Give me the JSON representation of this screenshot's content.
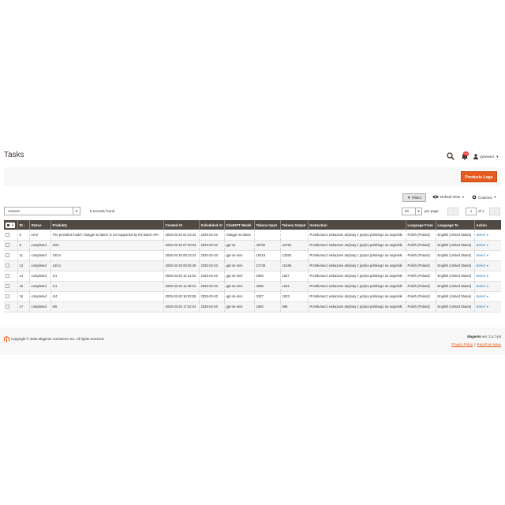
{
  "header": {
    "title": "Tasks",
    "notification_count": "99",
    "username": "sylwester"
  },
  "action_bar": {
    "primary_button": "Products Logs"
  },
  "toolbar": {
    "filters_label": "Filters",
    "view_label": "Default View",
    "columns_label": "Columns",
    "actions_label": "Actions",
    "records_found": "8 records found",
    "per_page_value": "20",
    "per_page_label": "per page",
    "current_page": "1",
    "page_of": "of 1"
  },
  "grid": {
    "columns": [
      "ID",
      "Status",
      "Produkty",
      "Created At",
      "Scheduled At",
      "ChatGPT Model",
      "Tokens Input",
      "Tokens Output",
      "Instruction",
      "Language From",
      "Language To",
      "Action"
    ],
    "action_link": "Select",
    "rows": [
      {
        "id": "6",
        "status": "error",
        "products": "The provided model 'chatgpt-4o-latest' is not supported by the Batch API.",
        "created": "2025-02-20 01:23:32",
        "scheduled": "2025-02-20",
        "model": "chatgpt-4o-latest",
        "tin": "",
        "tout": "",
        "instruction": "Przetłumacz wskazane atrybuty z języka polskiego na angielski",
        "lang_from": "Polish (Poland)",
        "lang_to": "English (United States)"
      },
      {
        "id": "9",
        "status": "completed",
        "products": "3/24",
        "created": "2025-02-20 07:20:04",
        "scheduled": "2025-02-20",
        "model": "gpt-4o",
        "tin": "46782",
        "tout": "22782",
        "instruction": "Przetłumacz wskazane atrybuty z języka polskiego na angielski",
        "lang_from": "Polish (Poland)",
        "lang_to": "English (United States)"
      },
      {
        "id": "11",
        "status": "completed",
        "products": "10/24",
        "created": "2025-02-20 08:13:42",
        "scheduled": "2025-02-20",
        "model": "gpt-4o-mini",
        "tin": "19218",
        "tout": "13393",
        "instruction": "Przetłumacz wskazane atrybuty z języka polskiego na angielski",
        "lang_from": "Polish (Poland)",
        "lang_to": "English (United States)"
      },
      {
        "id": "12",
        "status": "completed",
        "products": "14/14",
        "created": "2025-02-20 09:05:29",
        "scheduled": "2025-02-20",
        "model": "gpt-4o-mini",
        "tin": "21749",
        "tout": "15186",
        "instruction": "Przetłumacz wskazane atrybuty z języka polskiego na angielski",
        "lang_from": "Polish (Poland)",
        "lang_to": "English (United States)"
      },
      {
        "id": "14",
        "status": "completed",
        "products": "1/1",
        "created": "2025-02-20 11:14:52",
        "scheduled": "2025-02-20",
        "model": "gpt-4o-mini",
        "tin": "2056",
        "tout": "1647",
        "instruction": "Przetłumacz wskazane atrybuty z języka polskiego na angielski",
        "lang_from": "Polish (Poland)",
        "lang_to": "English (United States)"
      },
      {
        "id": "15",
        "status": "completed",
        "products": "1/1",
        "created": "2025-02-20 11:29:04",
        "scheduled": "2025-02-20",
        "model": "gpt-4o-mini",
        "tin": "2035",
        "tout": "1622",
        "instruction": "Przetłumacz wskazane atrybuty z języka polskiego na angielski",
        "lang_from": "Polish (Poland)",
        "lang_to": "English (United States)"
      },
      {
        "id": "16",
        "status": "completed",
        "products": "4/4",
        "created": "2025-02-20 16:02:55",
        "scheduled": "2025-02-20",
        "model": "gpt-4o-mini",
        "tin": "3327",
        "tout": "1823",
        "instruction": "Przetłumacz wskazane atrybuty z języka polskiego na angielski",
        "lang_from": "Polish (Poland)",
        "lang_to": "English (United States)"
      },
      {
        "id": "17",
        "status": "completed",
        "products": "6/6",
        "created": "2025-02-20 17:02:04",
        "scheduled": "2025-02-20",
        "model": "gpt-4o-mini",
        "tin": "1650",
        "tout": "696",
        "instruction": "Przetłumacz wskazane atrybuty z języka polskiego na angielski",
        "lang_from": "Polish (Poland)",
        "lang_to": "English (United States)"
      }
    ]
  },
  "footer": {
    "copyright": "Copyright © 2025 Magento Commerce Inc. All rights reserved.",
    "brand": "Magento",
    "version": "ver. 2.4.7-p4",
    "privacy_link": "Privacy Policy",
    "separator": "|",
    "report_link": "Report an Issue"
  },
  "colors": {
    "accent": "#eb5202",
    "header_bg": "#514943",
    "link": "#1979c3",
    "badge": "#e22626"
  }
}
